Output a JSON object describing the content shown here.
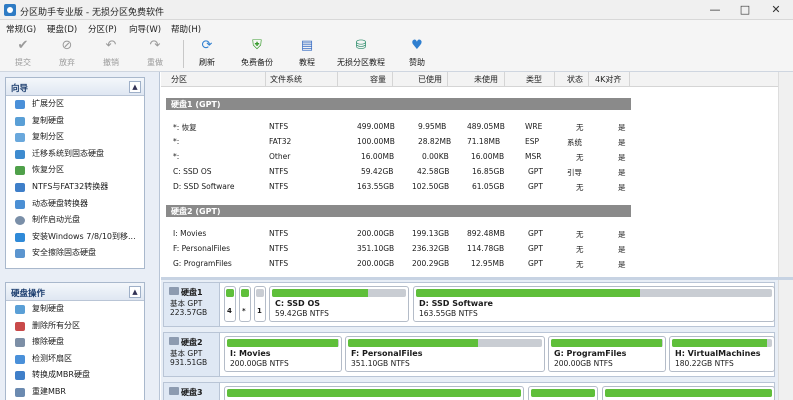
{
  "window": {
    "title": "分区助手专业版 - 无损分区免费软件",
    "minimize": "—",
    "maximize": "□",
    "close": "✕"
  },
  "menu": [
    "常规(G)",
    "硬盘(D)",
    "分区(P)",
    "向导(W)",
    "帮助(H)"
  ],
  "toolbar": {
    "commit": "提交",
    "discard": "放弃",
    "undo": "撤销",
    "redo": "重做",
    "refresh": "刷新",
    "backup": "免费备份",
    "tutorial": "教程",
    "lossless": "无损分区教程",
    "donate": "赞助"
  },
  "wizard": {
    "title": "向导",
    "items": [
      "扩展分区",
      "复制硬盘",
      "复制分区",
      "迁移系统到固态硬盘",
      "恢复分区",
      "NTFS与FAT32转换器",
      "动态硬盘转换器",
      "制作启动光盘",
      "安装Windows 7/8/10到移...",
      "安全擦除固态硬盘"
    ]
  },
  "diskops": {
    "title": "硬盘操作",
    "items": [
      "复制硬盘",
      "删除所有分区",
      "擦除硬盘",
      "检测坏扇区",
      "转换成MBR硬盘",
      "重建MBR"
    ]
  },
  "columns": [
    "分区",
    "文件系统",
    "容量",
    "已使用",
    "未使用",
    "类型",
    "状态",
    "4K对齐"
  ],
  "disk1": {
    "label": "硬盘1 (GPT)",
    "rows": [
      {
        "name": "*: 恢复",
        "fs": "NTFS",
        "cap": "499.00MB",
        "used": "9.95MB",
        "free": "489.05MB",
        "type": "WRE",
        "status": "无",
        "align": "是"
      },
      {
        "name": "*:",
        "fs": "FAT32",
        "cap": "100.00MB",
        "used": "28.82MB",
        "free": "71.18MB",
        "type": "ESP",
        "status": "系统",
        "align": "是"
      },
      {
        "name": "*:",
        "fs": "Other",
        "cap": "16.00MB",
        "used": "0.00KB",
        "free": "16.00MB",
        "type": "MSR",
        "status": "无",
        "align": "是"
      },
      {
        "name": "C: SSD OS",
        "fs": "NTFS",
        "cap": "59.42GB",
        "used": "42.58GB",
        "free": "16.85GB",
        "type": "GPT",
        "status": "引导",
        "align": "是"
      },
      {
        "name": "D: SSD Software",
        "fs": "NTFS",
        "cap": "163.55GB",
        "used": "102.50GB",
        "free": "61.05GB",
        "type": "GPT",
        "status": "无",
        "align": "是"
      }
    ]
  },
  "disk2": {
    "label": "硬盘2 (GPT)",
    "rows": [
      {
        "name": "I: Movies",
        "fs": "NTFS",
        "cap": "200.00GB",
        "used": "199.13GB",
        "free": "892.48MB",
        "type": "GPT",
        "status": "无",
        "align": "是"
      },
      {
        "name": "F: PersonalFiles",
        "fs": "NTFS",
        "cap": "351.10GB",
        "used": "236.32GB",
        "free": "114.78GB",
        "type": "GPT",
        "status": "无",
        "align": "是"
      },
      {
        "name": "G: ProgramFiles",
        "fs": "NTFS",
        "cap": "200.00GB",
        "used": "200.29GB",
        "free": "12.95MB",
        "type": "GPT",
        "status": "无",
        "align": "是"
      }
    ]
  },
  "map": {
    "disk1": {
      "name": "硬盘1",
      "kind": "基本 GPT",
      "size": "223.57GB",
      "small": [
        "4",
        "1"
      ],
      "parts": [
        {
          "name": "C: SSD OS",
          "size": "59.42GB NTFS",
          "usage": 0.72
        },
        {
          "name": "D: SSD Software",
          "size": "163.55GB NTFS",
          "usage": 0.63
        }
      ]
    },
    "disk2": {
      "name": "硬盘2",
      "kind": "基本 GPT",
      "size": "931.51GB",
      "parts": [
        {
          "name": "I: Movies",
          "size": "200.00GB NTFS",
          "usage": 0.99
        },
        {
          "name": "F: PersonalFiles",
          "size": "351.10GB NTFS",
          "usage": 0.67
        },
        {
          "name": "G: ProgramFiles",
          "size": "200.00GB NTFS",
          "usage": 0.99
        },
        {
          "name": "H: VirtualMachines",
          "size": "180.22GB NTFS",
          "usage": 0.95
        }
      ]
    },
    "disk3": {
      "name": "硬盘3"
    }
  }
}
